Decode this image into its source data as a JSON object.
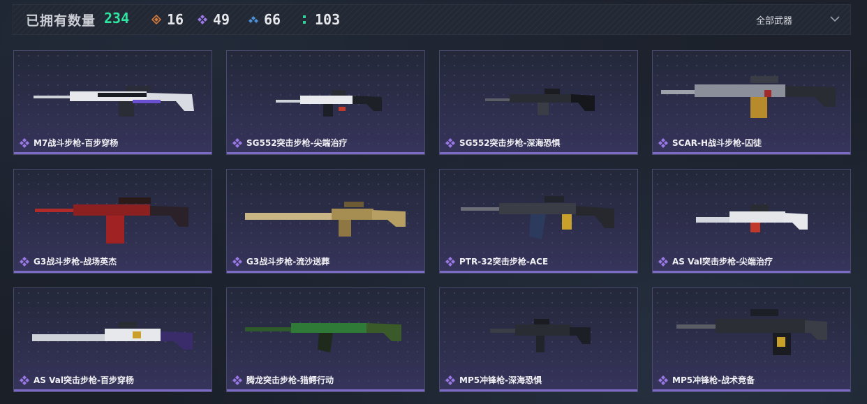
{
  "header": {
    "owned_label": "已拥有数量",
    "owned_total": "234",
    "rarity_counts": [
      {
        "icon": "orange-diamond-icon",
        "color": "#d07a3c",
        "value": "16"
      },
      {
        "icon": "purple-diamond-icon",
        "color": "#9a78e6",
        "value": "49"
      },
      {
        "icon": "blue-diamond-icon",
        "color": "#4a90d9",
        "value": "66"
      },
      {
        "icon": "green-dots-icon",
        "color": "#2fd39a",
        "value": "103"
      }
    ],
    "filter_label": "全部武器"
  },
  "colors": {
    "accent_green": "#2fe3a0",
    "rarity_purple": "#9a78e6"
  },
  "weapons": [
    {
      "name": "M7战斗步枪-百步穿杨"
    },
    {
      "name": "SG552突击步枪-尖端治疗"
    },
    {
      "name": "SG552突击步枪-深海恐惧"
    },
    {
      "name": "SCAR-H战斗步枪-囚徒"
    },
    {
      "name": "G3战斗步枪-战场英杰"
    },
    {
      "name": "G3战斗步枪-流沙送葬"
    },
    {
      "name": "PTR-32突击步枪-ACE"
    },
    {
      "name": "AS Val突击步枪-尖端治疗"
    },
    {
      "name": "AS Val突击步枪-百步穿杨"
    },
    {
      "name": "腾龙突击步枪-猎鳄行动"
    },
    {
      "name": "MP5冲锋枪-深海恐惧"
    },
    {
      "name": "MP5冲锋枪-战术竞备"
    }
  ]
}
